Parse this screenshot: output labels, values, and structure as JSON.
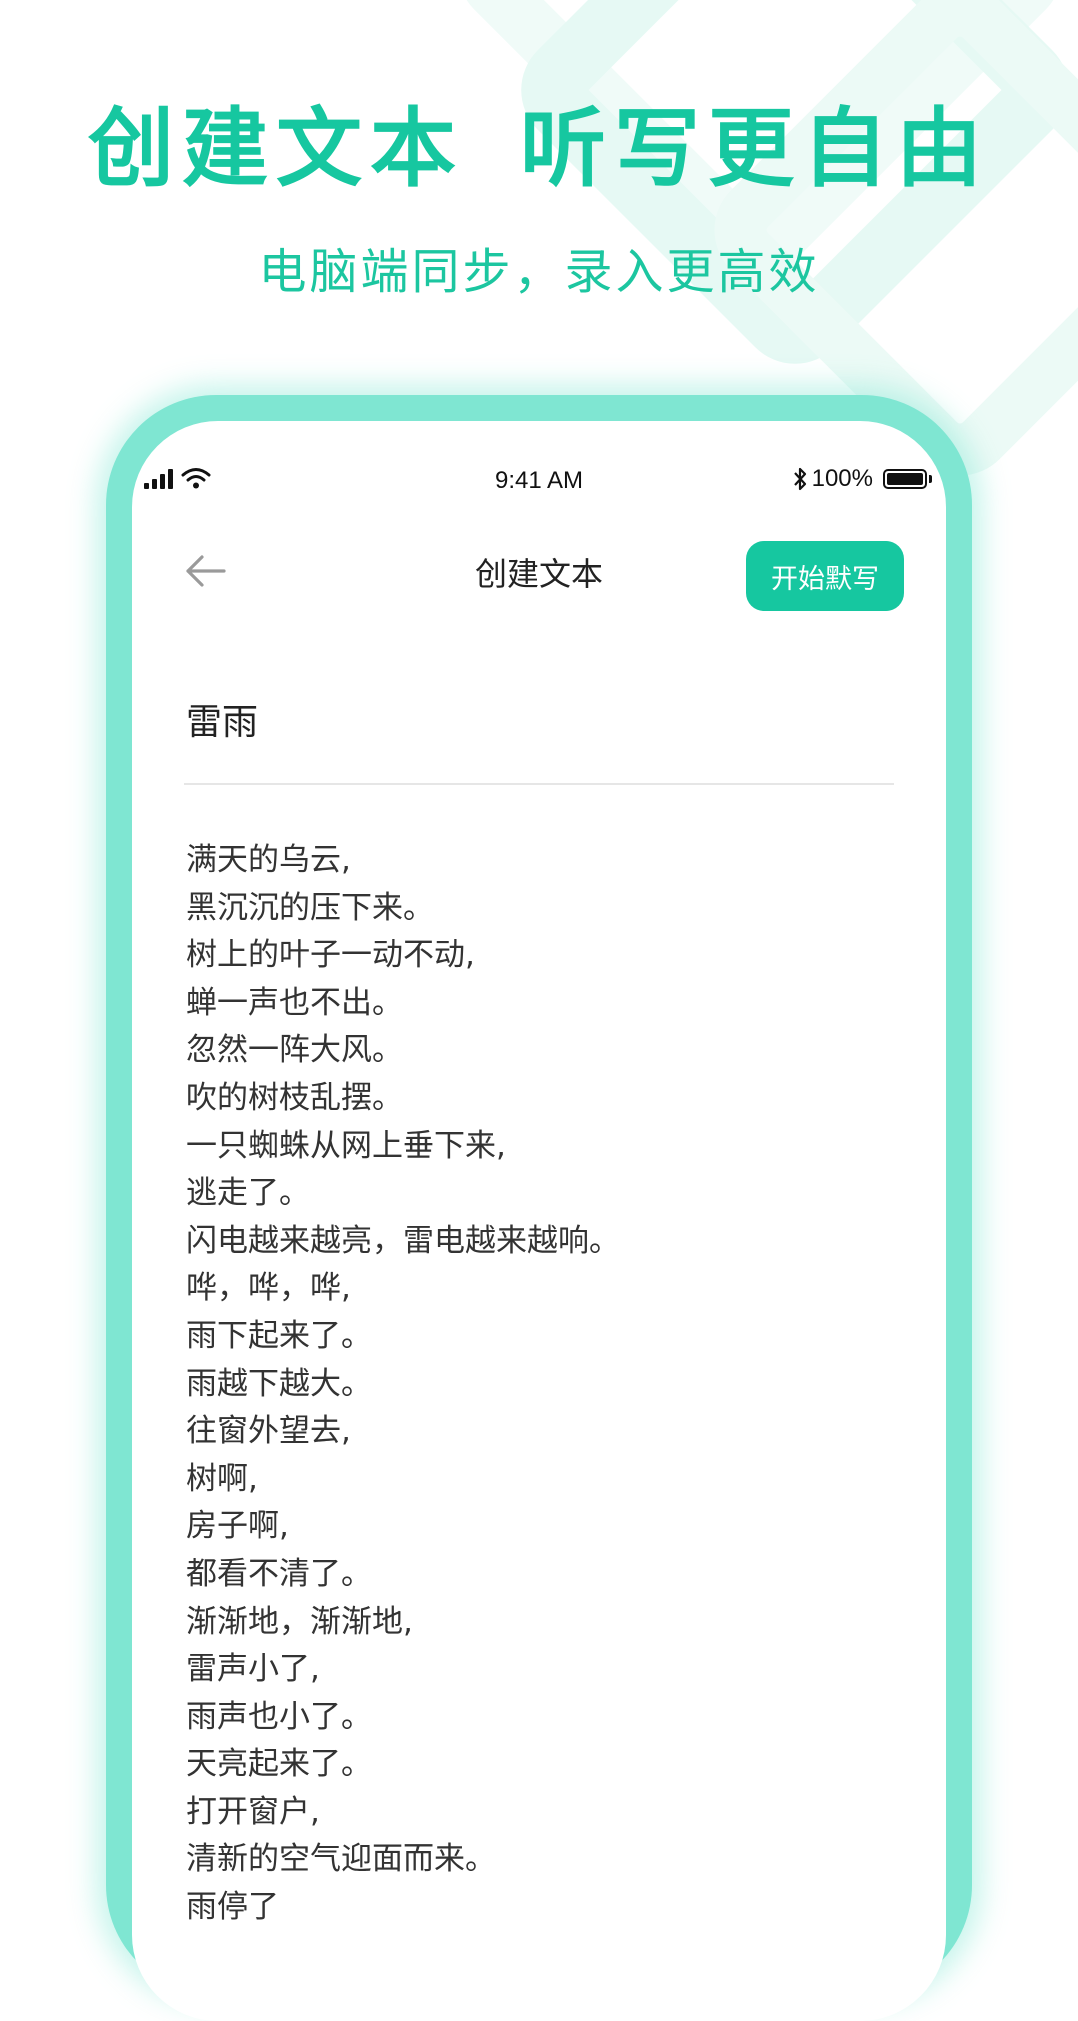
{
  "promo": {
    "headline_part1": "创建文本",
    "headline_part2": "听写更自由",
    "subheadline": "电脑端同步，录入更高效"
  },
  "status_bar": {
    "time": "9:41 AM",
    "battery_percent": "100%",
    "signal_icon": "signal-bars-icon",
    "wifi_icon": "wifi-icon",
    "bluetooth_icon": "bluetooth-icon",
    "battery_icon": "battery-icon"
  },
  "nav": {
    "back_icon": "arrow-left-icon",
    "title": "创建文本",
    "start_button": "开始默写"
  },
  "document": {
    "title": "雷雨",
    "lines": [
      "满天的乌云,",
      "黑沉沉的压下来。",
      "树上的叶子一动不动,",
      "蝉一声也不出。",
      "忽然一阵大风。",
      "吹的树枝乱摆。",
      "一只蜘蛛从网上垂下来,",
      "逃走了。",
      "闪电越来越亮，雷电越来越响。",
      "哗，哗，哗,",
      "雨下起来了。",
      "雨越下越大。",
      "往窗外望去,",
      "树啊,",
      "房子啊,",
      "都看不清了。",
      "渐渐地，渐渐地,",
      "雷声小了,",
      "雨声也小了。",
      "天亮起来了。",
      "打开窗户,",
      "清新的空气迎面而来。",
      "雨停了"
    ]
  },
  "colors": {
    "accent": "#16c7a0",
    "phone_frame": "#7fe6d2",
    "decor_light": "#e6f9f4"
  }
}
